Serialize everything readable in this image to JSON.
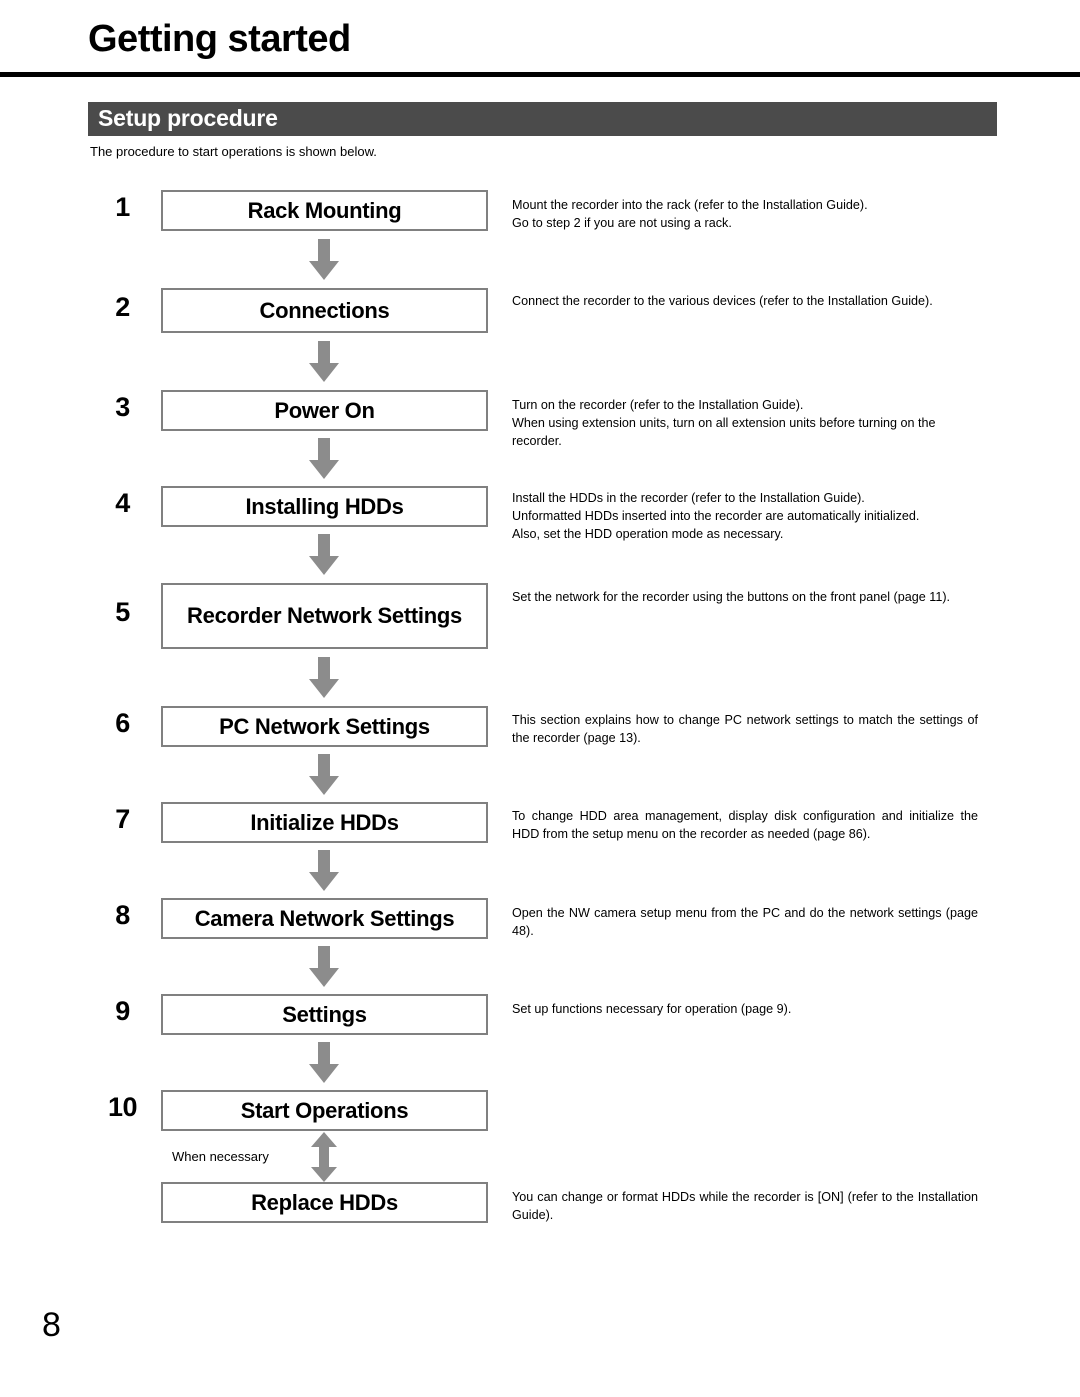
{
  "page": {
    "title": "Getting started",
    "number": "8"
  },
  "section": {
    "title": "Setup procedure",
    "intro": "The procedure to start operations is shown below.",
    "bar_color": "#4b4b4b",
    "arrow_color": "#8c8c8c",
    "box_border_color": "#808080"
  },
  "flow": {
    "steps": [
      {
        "number": "1",
        "label": "Rack Mounting",
        "desc_lines": [
          "Mount the recorder into the rack (refer to the Installation Guide).",
          "Go to step 2 if you are not using a rack."
        ],
        "justify": false,
        "connector": "arrow-down"
      },
      {
        "number": "2",
        "label": "Connections",
        "desc_lines": [
          "Connect the recorder to the various devices (refer to the Installation Guide)."
        ],
        "justify": true,
        "connector": "arrow-down"
      },
      {
        "number": "3",
        "label": "Power On",
        "desc_lines": [
          "Turn on the recorder (refer to the Installation Guide).",
          "When using extension units, turn on all extension units before turning on the recorder."
        ],
        "justify": false,
        "connector": "arrow-down"
      },
      {
        "number": "4",
        "label": "Installing HDDs",
        "desc_lines": [
          "Install the HDDs in the recorder (refer to the Installation Guide).",
          "Unformatted HDDs inserted into the recorder are automatically initialized.",
          "Also, set the HDD operation mode as necessary."
        ],
        "justify": false,
        "connector": "arrow-down"
      },
      {
        "number": "5",
        "label": "Recorder Network Settings",
        "desc_lines": [
          "Set the network for the recorder using the buttons on the front panel (page 11)."
        ],
        "justify": true,
        "connector": "arrow-down"
      },
      {
        "number": "6",
        "label": "PC Network Settings",
        "desc_lines": [
          "This section explains how to change PC network settings to match the settings of the recorder (page 13)."
        ],
        "justify": true,
        "connector": "arrow-down"
      },
      {
        "number": "7",
        "label": "Initialize HDDs",
        "desc_lines": [
          "To change HDD area management, display disk configuration and initialize the HDD from the setup menu on the recorder as needed (page 86)."
        ],
        "justify": true,
        "connector": "arrow-down"
      },
      {
        "number": "8",
        "label": "Camera Network Settings",
        "desc_lines": [
          "Open the NW camera setup menu from the PC and do the network settings (page 48)."
        ],
        "justify": true,
        "connector": "arrow-down"
      },
      {
        "number": "9",
        "label": "Settings",
        "desc_lines": [
          "Set up functions necessary for operation (page 9)."
        ],
        "justify": false,
        "connector": "arrow-down"
      },
      {
        "number": "10",
        "label": "Start Operations",
        "desc_lines": [],
        "justify": false,
        "connector": "arrow-both"
      },
      {
        "number": "",
        "label": "Replace HDDs",
        "desc_lines": [
          "You can change or format HDDs while the recorder is [ON] (refer to the Installation Guide)."
        ],
        "justify": true,
        "connector": "none"
      }
    ],
    "when_necessary_note": "When necessary"
  }
}
